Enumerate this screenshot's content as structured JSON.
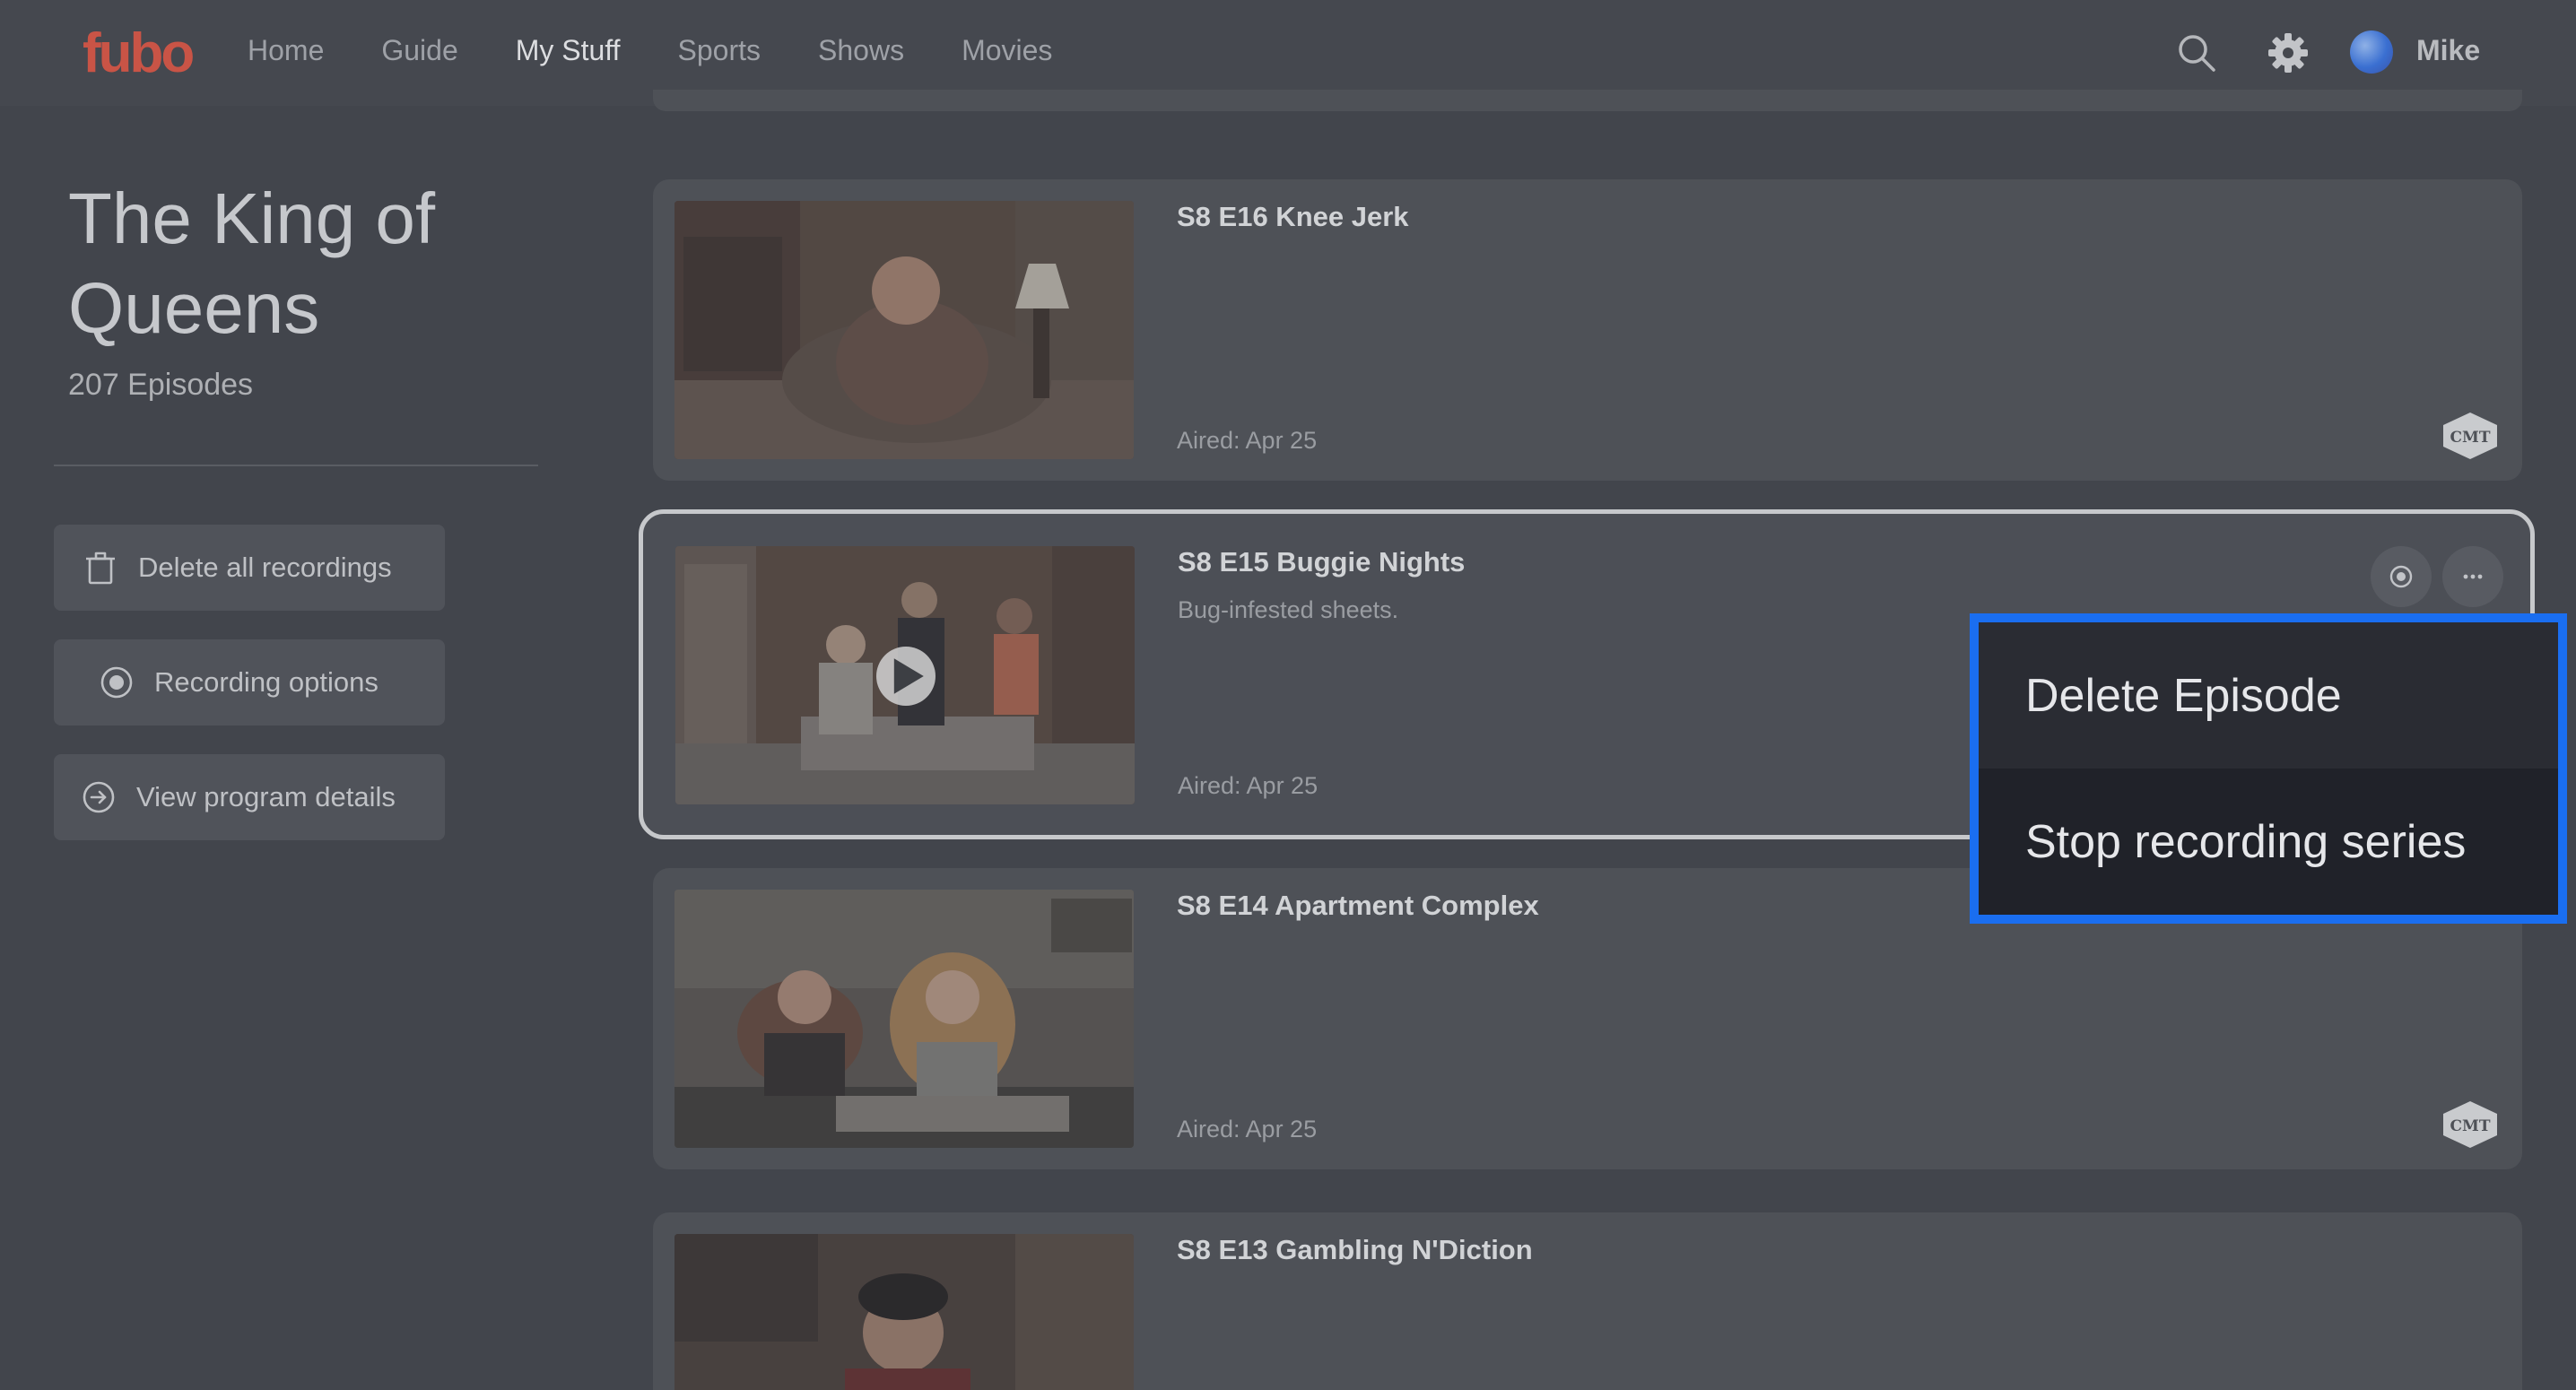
{
  "nav": {
    "logo": "fubo",
    "items": [
      {
        "label": "Home",
        "active": false
      },
      {
        "label": "Guide",
        "active": false
      },
      {
        "label": "My Stuff",
        "active": true
      },
      {
        "label": "Sports",
        "active": false
      },
      {
        "label": "Shows",
        "active": false
      },
      {
        "label": "Movies",
        "active": false
      }
    ],
    "user_name": "Mike"
  },
  "sidebar": {
    "show_title": "The King of Queens",
    "episode_count": "207 Episodes",
    "buttons": {
      "delete_all": "Delete all recordings",
      "recording_options": "Recording options",
      "view_details": "View program details"
    }
  },
  "episodes": [
    {
      "title": "S8 E16 Knee Jerk",
      "description": "",
      "aired": "Aired: Apr 25",
      "network": "CMT"
    },
    {
      "title": "S8 E15 Buggie Nights",
      "description": "Bug-infested sheets.",
      "aired": "Aired: Apr 25",
      "network": ""
    },
    {
      "title": "S8 E14 Apartment Complex",
      "description": "",
      "aired": "Aired: Apr 25",
      "network": "CMT"
    },
    {
      "title": "S8 E13 Gambling N'Diction",
      "description": "",
      "aired": "",
      "network": ""
    }
  ],
  "context_menu": {
    "items": [
      "Delete Episode",
      "Stop recording series"
    ]
  },
  "colors": {
    "accent_focus": "#1a6ef0",
    "logo": "#c95446",
    "background": "#42454c"
  },
  "icons": {
    "search": "search-icon",
    "settings": "gear-icon",
    "trash": "trash-icon",
    "record": "record-icon",
    "arrow": "arrow-right-circle-icon",
    "more": "more-dots-icon",
    "play": "play-icon"
  }
}
